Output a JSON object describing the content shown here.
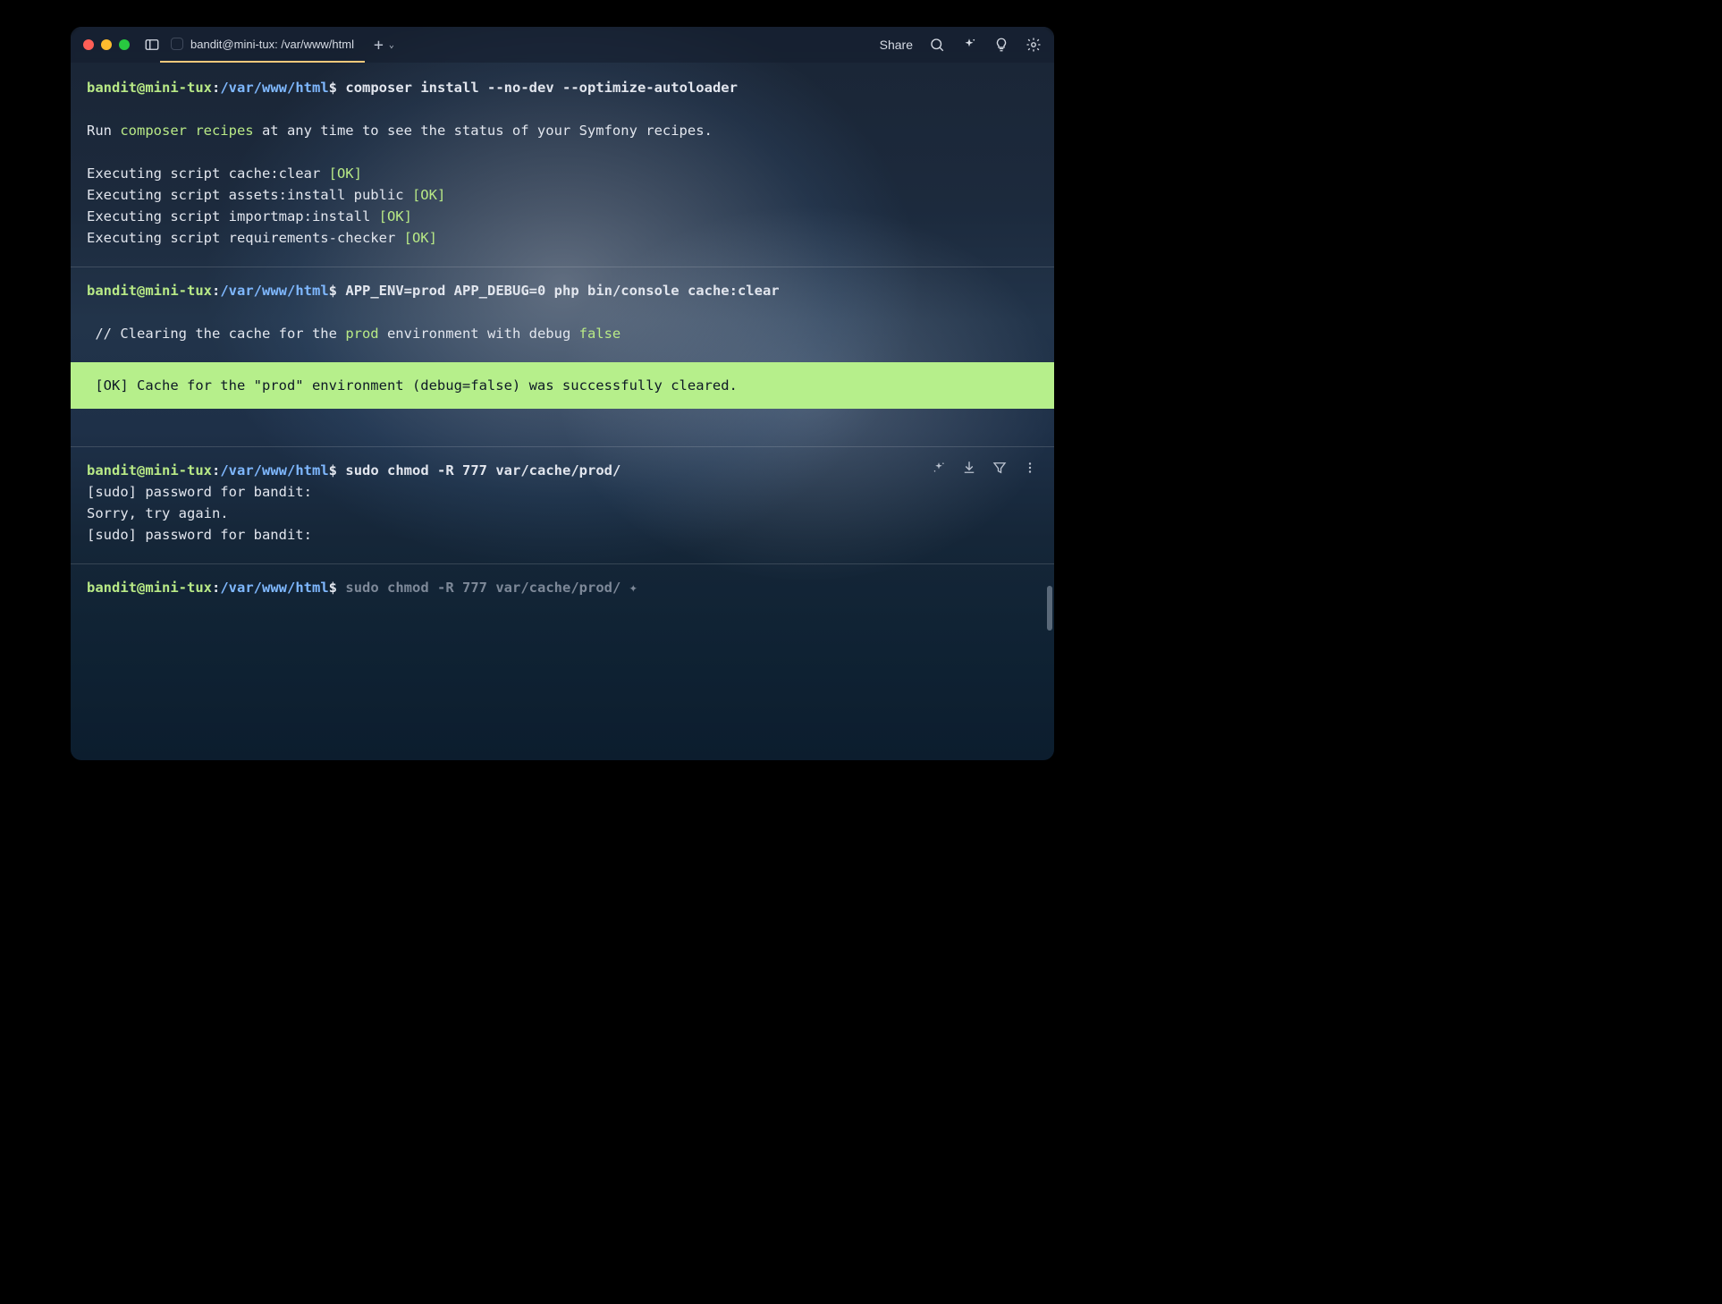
{
  "titlebar": {
    "tab_title": "bandit@mini-tux: /var/www/html",
    "share": "Share"
  },
  "prompt": {
    "user": "bandit",
    "host": "mini-tux",
    "path": "/var/www/html",
    "symbol": "$"
  },
  "blocks": [
    {
      "command": "composer install --no-dev --optimize-autoloader",
      "output": {
        "intro_pre": "Run ",
        "intro_hl": "composer recipes",
        "intro_post": " at any time to see the status of your Symfony recipes.",
        "scripts": [
          {
            "pre": "Executing script cache:clear ",
            "ok": "[OK]"
          },
          {
            "pre": "Executing script assets:install public ",
            "ok": "[OK]"
          },
          {
            "pre": "Executing script importmap:install ",
            "ok": "[OK]"
          },
          {
            "pre": "Executing script requirements-checker ",
            "ok": "[OK]"
          }
        ]
      }
    },
    {
      "command": "APP_ENV=prod APP_DEBUG=0 php bin/console cache:clear",
      "comment": {
        "pre": " // Clearing the cache for the ",
        "prod": "prod",
        "mid": " environment with debug ",
        "false": "false"
      },
      "banner": " [OK] Cache for the \"prod\" environment (debug=false) was successfully cleared.   "
    },
    {
      "command": "sudo chmod -R 777 var/cache/prod/",
      "lines": [
        "[sudo] password for bandit: ",
        "Sorry, try again.",
        "[sudo] password for bandit: "
      ]
    },
    {
      "suggestion": "sudo chmod -R 777 var/cache/prod/ "
    }
  ]
}
